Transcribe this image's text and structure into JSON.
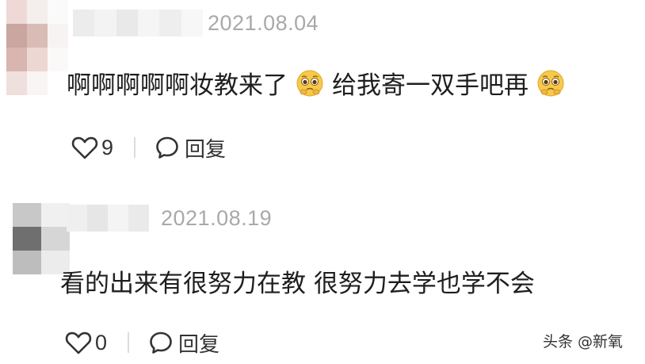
{
  "comments": [
    {
      "timestamp": "2021.08.04",
      "text_part1": "啊啊啊啊啊妆教来了",
      "text_part2": "给我寄一双手吧再",
      "emoji": "pleading-face-emoji",
      "like_count": "9",
      "reply_label": "回复"
    },
    {
      "timestamp": "2021.08.19",
      "text": "看的出来有很努力在教 很努力去学也学不会",
      "like_count": "0",
      "reply_label": "回复"
    }
  ],
  "watermark": "头条 @新氧",
  "colors": {
    "timestamp": "#a9a9a9",
    "text": "#1e1e1e",
    "divider": "#dcdcdc",
    "emoji_yellow": "#f6c94a"
  }
}
